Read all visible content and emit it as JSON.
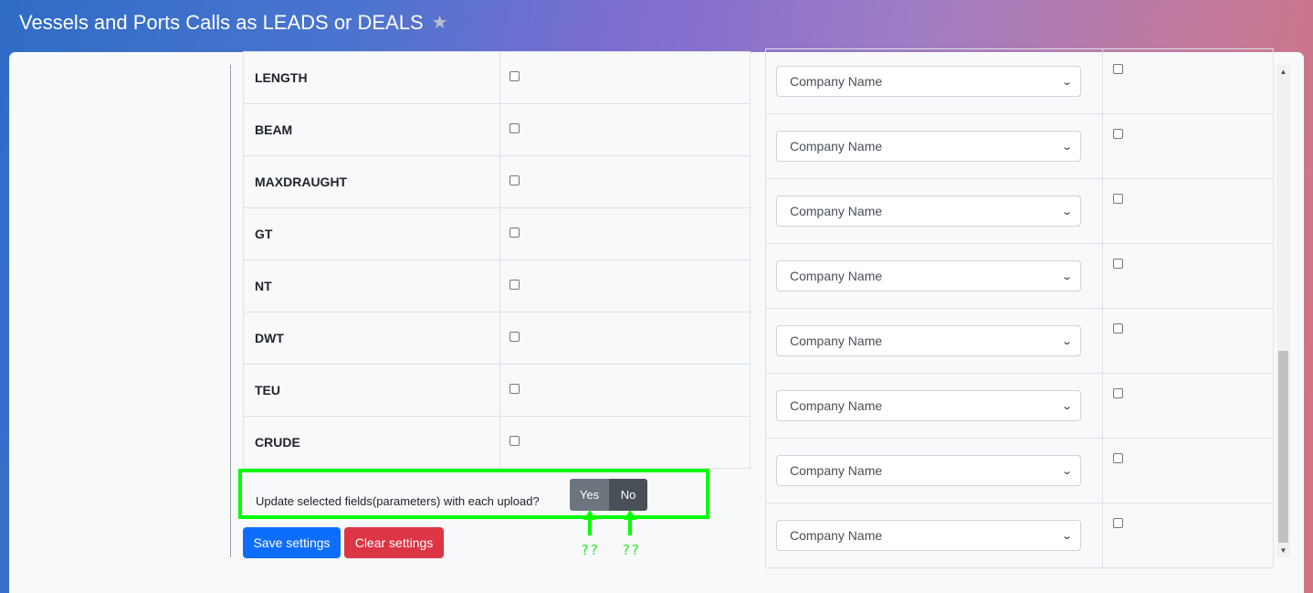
{
  "header": {
    "title": "Vessels and Ports Calls as LEADS or DEALS"
  },
  "fields": [
    {
      "name": "LENGTH"
    },
    {
      "name": "BEAM"
    },
    {
      "name": "MAXDRAUGHT"
    },
    {
      "name": "GT"
    },
    {
      "name": "NT"
    },
    {
      "name": "DWT"
    },
    {
      "name": "TEU"
    },
    {
      "name": "CRUDE"
    }
  ],
  "mappings": [
    {
      "value": "Company Name"
    },
    {
      "value": "Company Name"
    },
    {
      "value": "Company Name"
    },
    {
      "value": "Company Name"
    },
    {
      "value": "Company Name"
    },
    {
      "value": "Company Name"
    },
    {
      "value": "Company Name"
    },
    {
      "value": "Company Name"
    }
  ],
  "update": {
    "question": "Update selected fields(parameters) with each upload?",
    "yes_label": "Yes",
    "no_label": "No"
  },
  "actions": {
    "save_label": "Save settings",
    "clear_label": "Clear settings"
  },
  "annotations": {
    "yes_note": "??",
    "no_note": "??"
  },
  "colors": {
    "highlight": "#00ff00",
    "primary": "#0d6efd",
    "danger": "#dc3545",
    "secondary": "#6c757d",
    "dark": "#495057"
  },
  "icons": {
    "favorite": "star-icon",
    "select": "chevron-down-icon",
    "annotation": "arrow-up-icon"
  }
}
